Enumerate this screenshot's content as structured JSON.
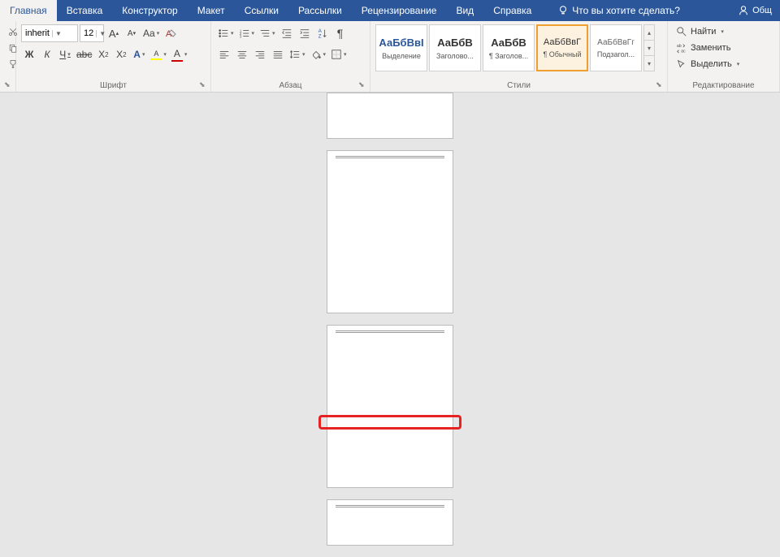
{
  "menu": {
    "tabs": [
      "Главная",
      "Вставка",
      "Конструктор",
      "Макет",
      "Ссылки",
      "Рассылки",
      "Рецензирование",
      "Вид",
      "Справка"
    ],
    "active_index": 0,
    "tell_me": "Что вы хотите сделать?",
    "share": "Общ"
  },
  "ribbon": {
    "font": {
      "label": "Шрифт",
      "font_name": "inherit",
      "font_size": "12",
      "bold": "Ж",
      "italic": "К",
      "underline": "Ч",
      "strike": "abc",
      "subscript": "X",
      "superscript": "X",
      "case": "Aa",
      "clear_format": "A",
      "grow": "A",
      "shrink": "A",
      "highlight": "A",
      "font_color": "A",
      "text_effects": "A"
    },
    "paragraph": {
      "label": "Абзац",
      "pilcrow": "¶"
    },
    "styles": {
      "label": "Стили",
      "items": [
        {
          "preview": "АаБбВвІ",
          "name": "Выделение",
          "blue": true
        },
        {
          "preview": "АаБбВ",
          "name": "Заголово...",
          "blue": false
        },
        {
          "preview": "АаБбВ",
          "name": "¶ Заголов...",
          "blue": false
        },
        {
          "preview": "АаБбВвГ",
          "name": "¶ Обычный",
          "blue": false
        },
        {
          "preview": "АаБбВвГг",
          "name": "Подзагол...",
          "blue": false
        }
      ],
      "selected_index": 3
    },
    "editing": {
      "label": "Редактирование",
      "find": "Найти",
      "replace": "Заменить",
      "select": "Выделить"
    }
  }
}
